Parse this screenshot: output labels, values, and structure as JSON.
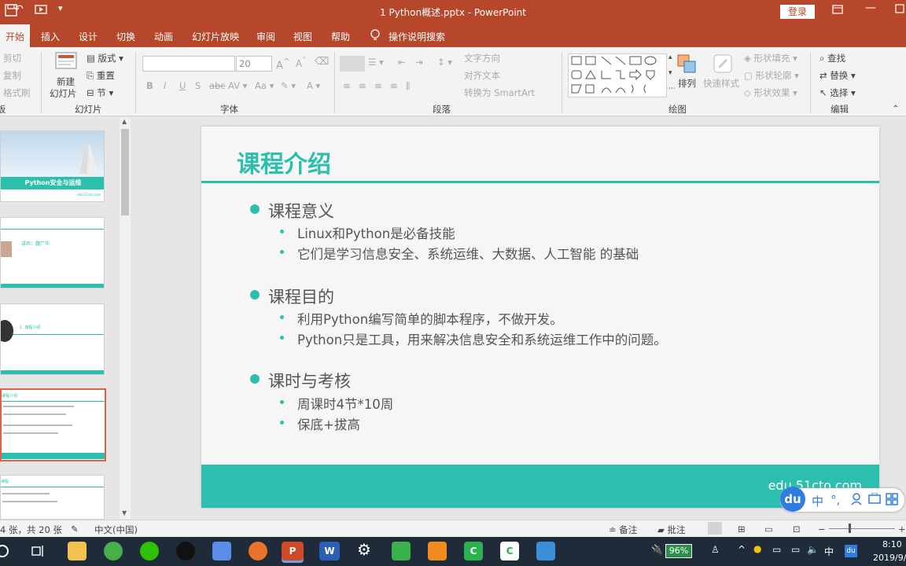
{
  "titlebar": {
    "title": "1 Python概述.pptx  -  PowerPoint",
    "login_label": "登录",
    "colors": {
      "accent": "#b7472a"
    }
  },
  "tabs": [
    {
      "label": "开始"
    },
    {
      "label": "插入"
    },
    {
      "label": "设计"
    },
    {
      "label": "切换"
    },
    {
      "label": "动画"
    },
    {
      "label": "幻灯片放映"
    },
    {
      "label": "审阅"
    },
    {
      "label": "视图"
    },
    {
      "label": "帮助"
    },
    {
      "label": "操作说明搜索"
    }
  ],
  "ribbon": {
    "clipboard": {
      "cut": "剪切",
      "copy": "复制",
      "painter": "格式刷"
    },
    "slides": {
      "new_slide_l1": "新建",
      "new_slide_l2": "幻灯片",
      "layout": "版式",
      "reset": "重置",
      "section": "节",
      "group": "幻灯片"
    },
    "font": {
      "size": "20",
      "group": "字体"
    },
    "paragraph": {
      "text_dir": "文字方向",
      "align_text": "对齐文本",
      "smartart": "转换为 SmartArt",
      "group": "段落"
    },
    "drawing": {
      "arrange": "排列",
      "quick_styles": "快速样式",
      "shape_fill": "形状填充",
      "shape_outline": "形状轮廓",
      "shape_effects": "形状效果",
      "group": "绘图"
    },
    "editing": {
      "find": "查找",
      "replace": "替换",
      "select": "选择",
      "group": "编辑"
    }
  },
  "thumbnails": [
    {
      "title": "Python安全与运维",
      "foot": "edu.51cto.com"
    },
    {
      "text": "讲师：魏广华"
    },
    {
      "text": "1.  课程介绍"
    },
    {
      "text": "课程介绍"
    },
    {
      "text": "课程"
    }
  ],
  "slide": {
    "title": "课程介绍",
    "sections": [
      {
        "heading": "课程意义",
        "items": [
          "Linux和Python是必备技能",
          "它们是学习信息安全、系统运维、大数据、人工智能 的基础"
        ]
      },
      {
        "heading": "课程目的",
        "items": [
          "利用Python编写简单的脚本程序，不做开发。",
          "Python只是工具，用来解决信息安全和系统运维工作中的问题。"
        ]
      },
      {
        "heading": "课时与考核",
        "items": [
          "周课时4节*10周",
          "保底+拔高"
        ]
      }
    ],
    "footer": "edu.51cto.com",
    "colors": {
      "accent": "#2cbfae"
    }
  },
  "statusbar": {
    "slide_count": "4 张，共 20 张",
    "language": "中文(中国)",
    "notes": "备注",
    "comments": "批注"
  },
  "ime": {
    "logo": "du",
    "mode": "中",
    "punct": "°,"
  },
  "taskbar": {
    "battery": "96%",
    "ime_lang": "中",
    "time": "8:10",
    "date": "2019/9/"
  }
}
